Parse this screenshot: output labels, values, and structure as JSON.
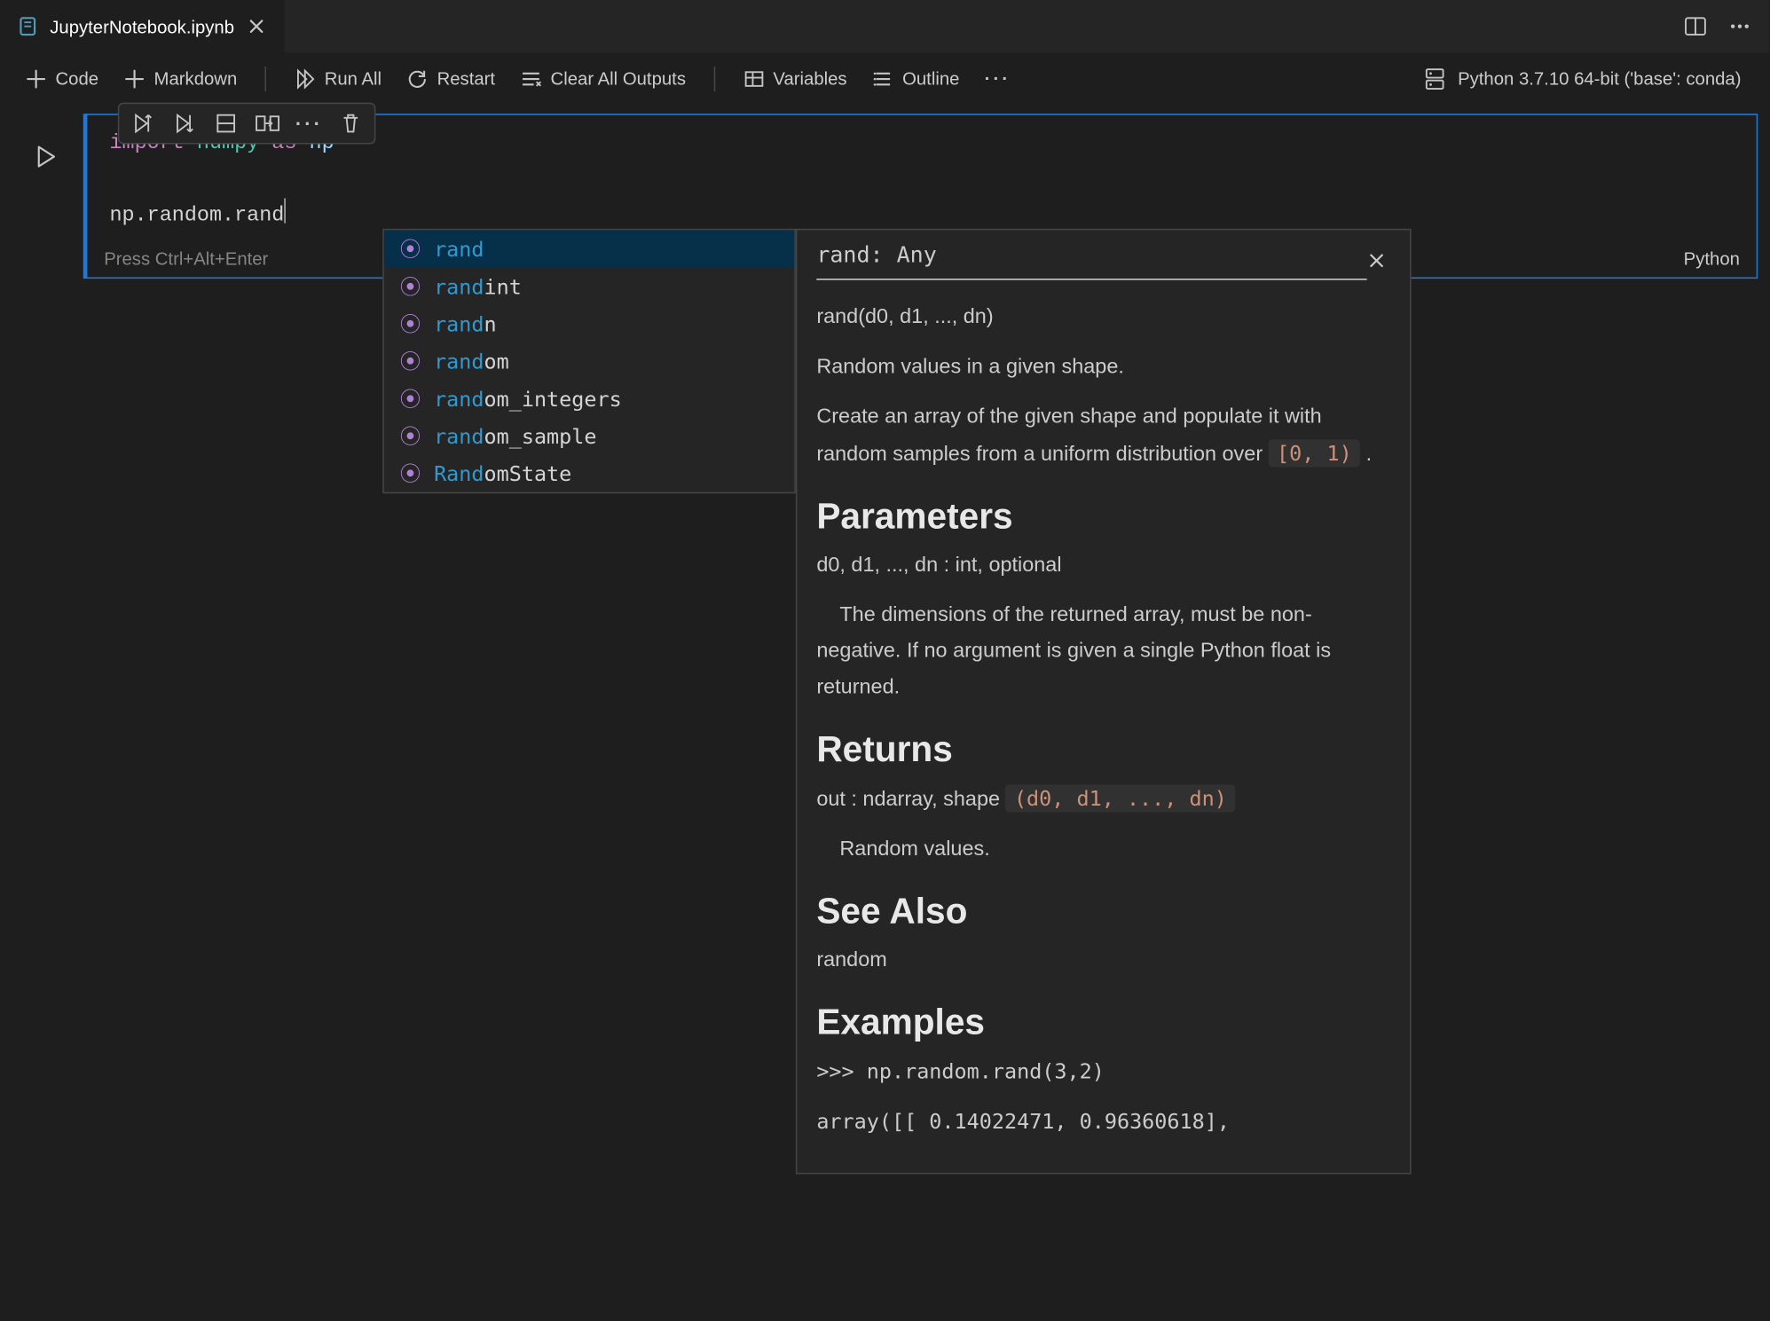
{
  "tab": {
    "title": "JupyterNotebook.ipynb"
  },
  "toolbar": {
    "code": "Code",
    "markdown": "Markdown",
    "run_all": "Run All",
    "restart": "Restart",
    "clear_outputs": "Clear All Outputs",
    "variables": "Variables",
    "outline": "Outline"
  },
  "kernel": {
    "label": "Python 3.7.10 64-bit ('base': conda)"
  },
  "cell": {
    "code_line1_kw": "import",
    "code_line1_mod": " numpy ",
    "code_line1_as": "as",
    "code_line1_alias": " np",
    "code_line3": "np.random.rand",
    "hint": "Press Ctrl+Alt+Enter",
    "language": "Python"
  },
  "suggest": {
    "items": [
      {
        "match": "rand",
        "rest": ""
      },
      {
        "match": "rand",
        "rest": "int"
      },
      {
        "match": "rand",
        "rest": "n"
      },
      {
        "match": "rand",
        "rest": "om"
      },
      {
        "match": "rand",
        "rest": "om_integers"
      },
      {
        "match": "rand",
        "rest": "om_sample"
      },
      {
        "match": "Rand",
        "rest": "omState"
      }
    ]
  },
  "doc": {
    "signature": "rand: Any",
    "call": "rand(d0, d1, ..., dn)",
    "summary": "Random values in a given shape.",
    "desc_pre": "Create an array of the given shape and populate it with random samples from a uniform distribution over ",
    "desc_code": "[0, 1)",
    "desc_post": " .",
    "h_params": "Parameters",
    "params_line1": "d0, d1, ..., dn : int, optional",
    "params_line2": "    The dimensions of the returned array, must be non-negative. If no argument is given a single Python float is returned.",
    "h_returns": "Returns",
    "returns_pre": "out : ndarray, shape ",
    "returns_code": "(d0, d1, ..., dn)",
    "returns_line2": "    Random values.",
    "h_seealso": "See Also",
    "seealso": "random",
    "h_examples": "Examples",
    "ex_line1": ">>> np.random.rand(3,2)",
    "ex_line2": "array([[ 0.14022471,  0.96360618],"
  }
}
